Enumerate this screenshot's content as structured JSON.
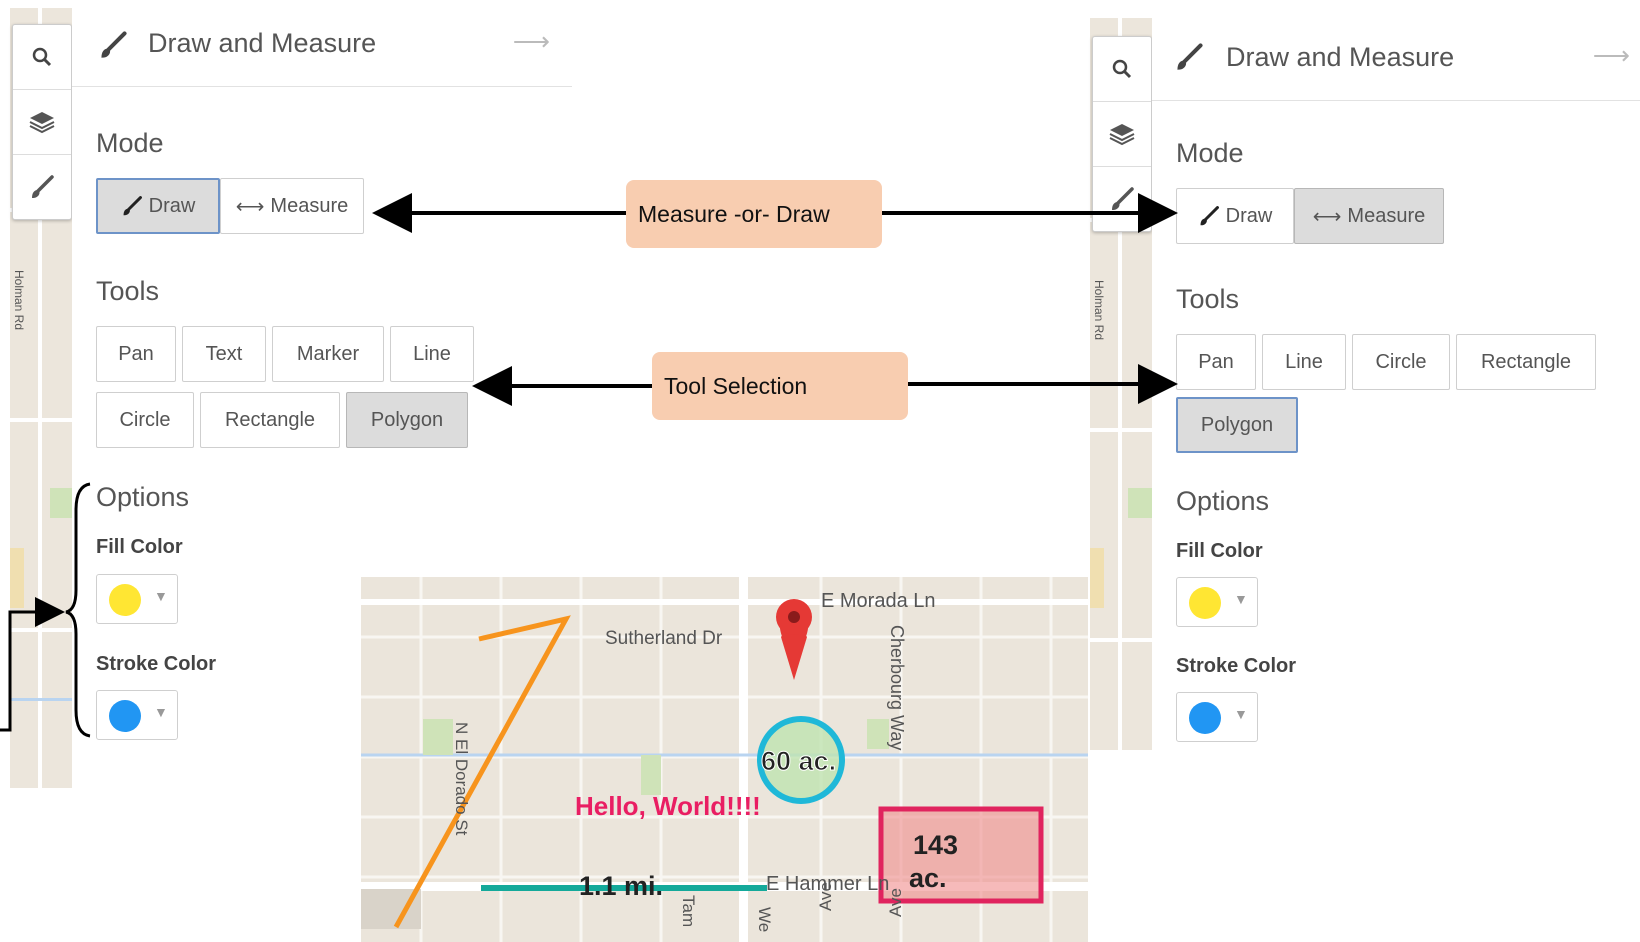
{
  "left_panel": {
    "title": "Draw and Measure",
    "mode": {
      "heading": "Mode",
      "buttons": [
        "Draw",
        "Measure"
      ],
      "selected": "Draw"
    },
    "tools": {
      "heading": "Tools",
      "buttons": [
        "Pan",
        "Text",
        "Marker",
        "Line",
        "Circle",
        "Rectangle",
        "Polygon"
      ],
      "selected": "Polygon"
    },
    "options": {
      "heading": "Options",
      "fill_label": "Fill Color",
      "fill_color": "#ffe633",
      "stroke_label": "Stroke Color",
      "stroke_color": "#2196f3"
    },
    "map_street": "Holman Rd"
  },
  "right_panel": {
    "title": "Draw and Measure",
    "mode": {
      "heading": "Mode",
      "buttons": [
        "Draw",
        "Measure"
      ],
      "selected": "Measure"
    },
    "tools": {
      "heading": "Tools",
      "buttons": [
        "Pan",
        "Line",
        "Circle",
        "Rectangle",
        "Polygon"
      ],
      "selected": "Polygon"
    },
    "options": {
      "heading": "Options",
      "fill_label": "Fill Color",
      "fill_color": "#ffe633",
      "stroke_label": "Stroke Color",
      "stroke_color": "#2196f3"
    },
    "map_street": "Holman Rd"
  },
  "callouts": {
    "mode": "Measure -or-  Draw",
    "tools": "Tool Selection"
  },
  "map": {
    "streets": [
      "E Morada Ln",
      "Sutherland Dr",
      "Cherbourg Way",
      "N El Dorado St",
      "E Hammer Ln",
      "Tam",
      "We",
      "Ave",
      "Ave"
    ],
    "circle_label": "60 ac.",
    "text_label": "Hello, World!!!!",
    "line_label": "1.1 mi.",
    "rect_label_1": "143",
    "rect_label_2": "ac.",
    "colors": {
      "line": "#f7941d",
      "circle": "#1fb8d8",
      "text": "#e91e63",
      "rect": "#e0245e",
      "measure": "#14a99a",
      "marker": "#e53935"
    }
  }
}
